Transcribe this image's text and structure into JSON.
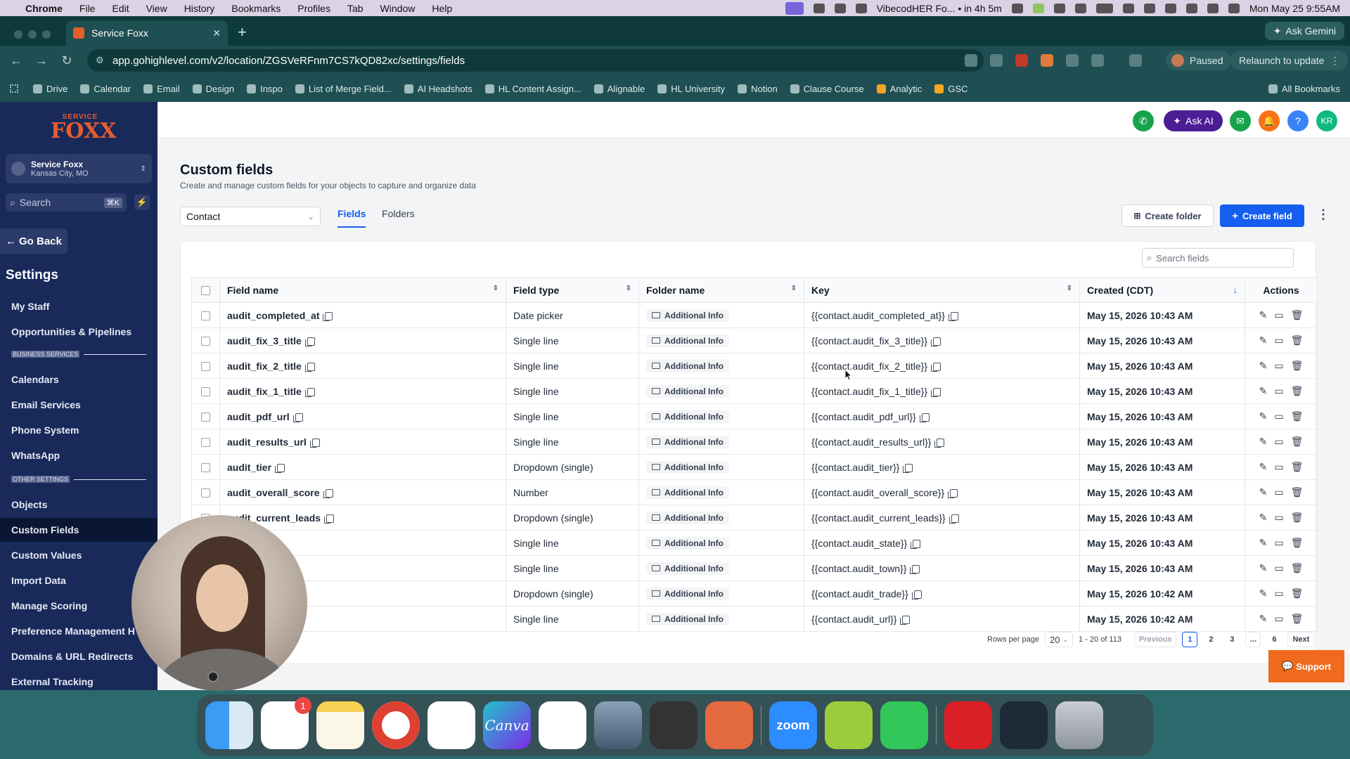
{
  "menubar": {
    "app": "Chrome",
    "items": [
      "File",
      "Edit",
      "View",
      "History",
      "Bookmarks",
      "Profiles",
      "Tab",
      "Window",
      "Help"
    ],
    "meeting": "VibecodHER Fo... • in 4h 5m",
    "datetime": "Mon May 25  9:55AM"
  },
  "browser": {
    "tab_title": "Service Foxx",
    "ask_gemini": "Ask Gemini",
    "url": "app.gohighlevel.com/v2/location/ZGSVeRFnm7CS7kQD82xc/settings/fields",
    "paused": "Paused",
    "relaunch": "Relaunch to update",
    "bookmarks": [
      "Drive",
      "Calendar",
      "Email",
      "Design",
      "Inspo",
      "List of Merge Field...",
      "AI Headshots",
      "HL Content Assign...",
      "Alignable",
      "HL University",
      "Notion",
      "Clause Course",
      "Analytic",
      "GSC"
    ],
    "all_bookmarks": "All Bookmarks"
  },
  "sidebar": {
    "logo_top": "SERVICE",
    "logo_main": "FOXX",
    "location_name": "Service Foxx",
    "location_city": "Kansas City, MO",
    "search_placeholder": "Search",
    "search_shortcut": "⌘K",
    "go_back": "Go Back",
    "settings_title": "Settings",
    "items_top": [
      "My Staff",
      "Opportunities & Pipelines"
    ],
    "section_business": "BUSINESS SERVICES",
    "items_business": [
      "Calendars",
      "Email Services",
      "Phone System",
      "WhatsApp"
    ],
    "section_other": "OTHER SETTINGS",
    "items_other": [
      "Objects",
      "Custom Fields",
      "Custom Values",
      "Import Data",
      "Manage Scoring",
      "Preference Management H",
      "Domains & URL Redirects",
      "External Tracking"
    ],
    "active_item": "Custom Fields"
  },
  "header": {
    "ask_ai": "Ask AI",
    "user_initials": "KR"
  },
  "page": {
    "title": "Custom fields",
    "subtitle": "Create and manage custom fields for your objects to capture and organize data",
    "object_selected": "Contact",
    "tabs": [
      "Fields",
      "Folders"
    ],
    "active_tab": "Fields",
    "create_folder": "Create folder",
    "create_field": "Create field",
    "search_placeholder": "Search fields"
  },
  "table": {
    "columns": [
      "Field name",
      "Field type",
      "Folder name",
      "Key",
      "Created (CDT)",
      "Actions"
    ],
    "rows": [
      {
        "name": "audit_completed_at",
        "type": "Date picker",
        "folder": "Additional Info",
        "key": "{{contact.audit_completed_at}}",
        "created": "May 15, 2026 10:43 AM"
      },
      {
        "name": "audit_fix_3_title",
        "type": "Single line",
        "folder": "Additional Info",
        "key": "{{contact.audit_fix_3_title}}",
        "created": "May 15, 2026 10:43 AM"
      },
      {
        "name": "audit_fix_2_title",
        "type": "Single line",
        "folder": "Additional Info",
        "key": "{{contact.audit_fix_2_title}}",
        "created": "May 15, 2026 10:43 AM"
      },
      {
        "name": "audit_fix_1_title",
        "type": "Single line",
        "folder": "Additional Info",
        "key": "{{contact.audit_fix_1_title}}",
        "created": "May 15, 2026 10:43 AM"
      },
      {
        "name": "audit_pdf_url",
        "type": "Single line",
        "folder": "Additional Info",
        "key": "{{contact.audit_pdf_url}}",
        "created": "May 15, 2026 10:43 AM"
      },
      {
        "name": "audit_results_url",
        "type": "Single line",
        "folder": "Additional Info",
        "key": "{{contact.audit_results_url}}",
        "created": "May 15, 2026 10:43 AM"
      },
      {
        "name": "audit_tier",
        "type": "Dropdown (single)",
        "folder": "Additional Info",
        "key": "{{contact.audit_tier}}",
        "created": "May 15, 2026 10:43 AM"
      },
      {
        "name": "audit_overall_score",
        "type": "Number",
        "folder": "Additional Info",
        "key": "{{contact.audit_overall_score}}",
        "created": "May 15, 2026 10:43 AM"
      },
      {
        "name": "audit_current_leads",
        "type": "Dropdown (single)",
        "folder": "Additional Info",
        "key": "{{contact.audit_current_leads}}",
        "created": "May 15, 2026 10:43 AM"
      },
      {
        "name": "",
        "type": "Single line",
        "folder": "Additional Info",
        "key": "{{contact.audit_state}}",
        "created": "May 15, 2026 10:43 AM"
      },
      {
        "name": "",
        "type": "Single line",
        "folder": "Additional Info",
        "key": "{{contact.audit_town}}",
        "created": "May 15, 2026 10:43 AM"
      },
      {
        "name": "",
        "type": "Dropdown (single)",
        "folder": "Additional Info",
        "key": "{{contact.audit_trade}}",
        "created": "May 15, 2026 10:42 AM"
      },
      {
        "name": "",
        "type": "Single line",
        "folder": "Additional Info",
        "key": "{{contact.audit_url}}",
        "created": "May 15, 2026 10:42 AM"
      }
    ]
  },
  "pagination": {
    "rows_per_page_label": "Rows per page",
    "rows_per_page": "20",
    "range": "1 - 20 of 113",
    "previous": "Previous",
    "pages": [
      "1",
      "2",
      "3",
      "...",
      "6"
    ],
    "current_page": "1",
    "next": "Next"
  },
  "support": "Support",
  "dock": {
    "reminders_badge": "1",
    "zoom_label": "zoom",
    "canva_label": "Canva"
  }
}
